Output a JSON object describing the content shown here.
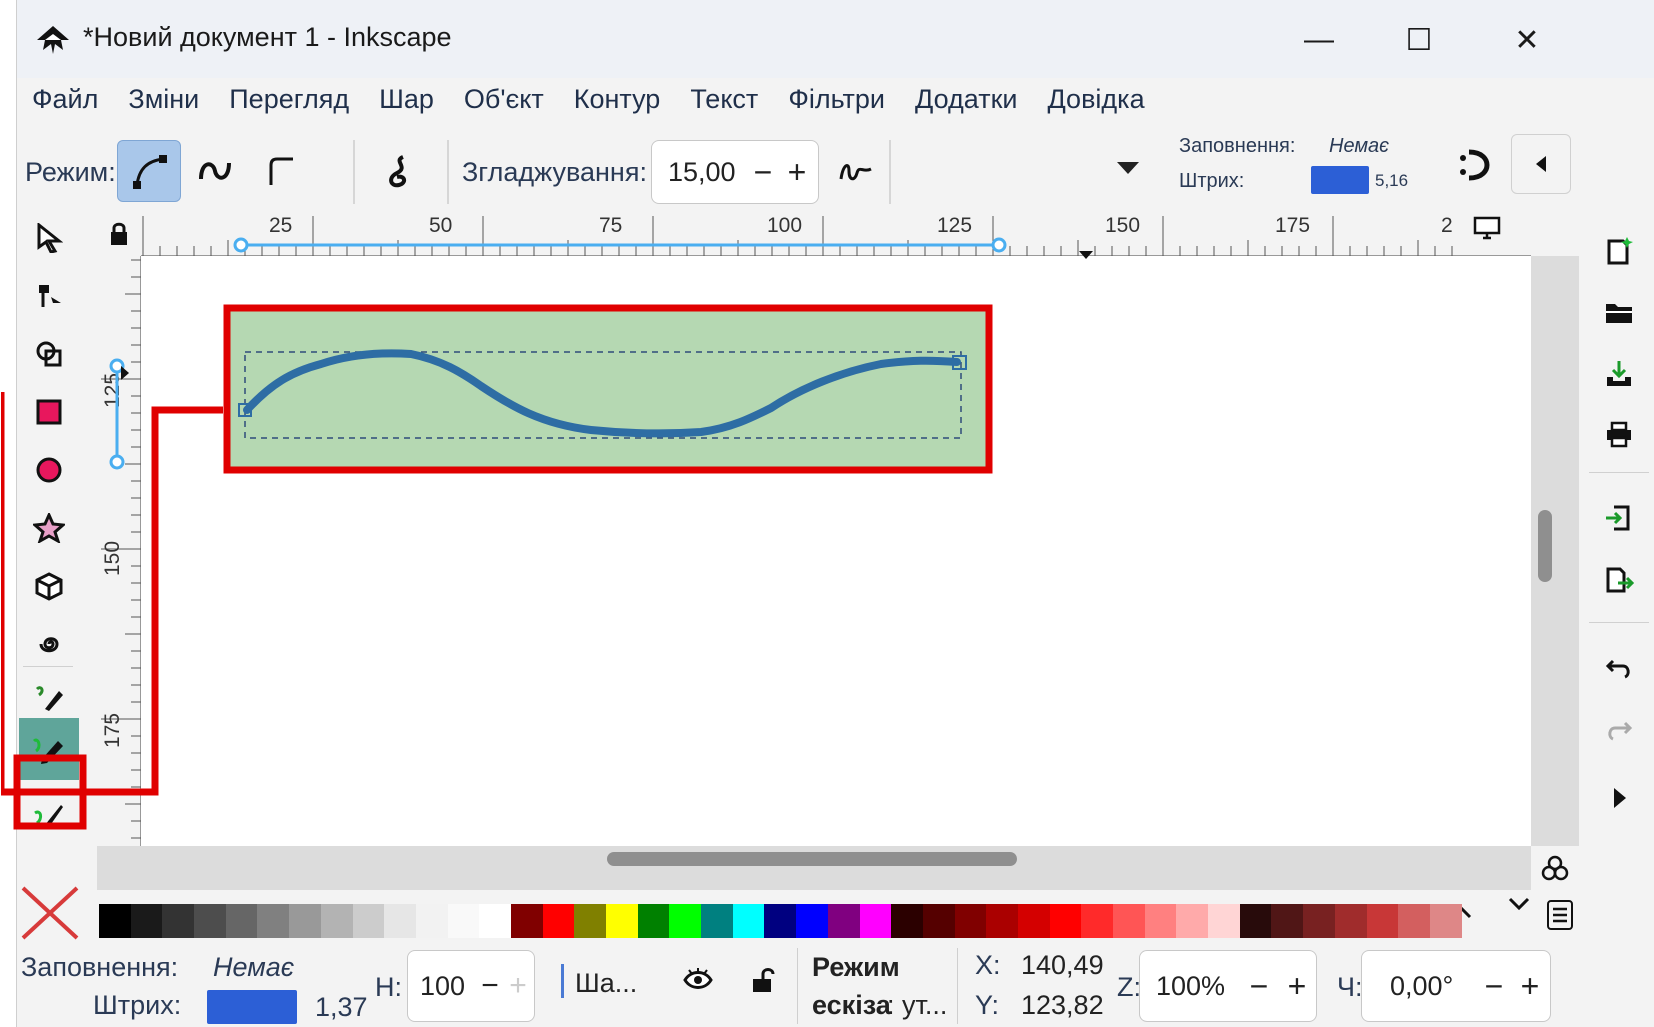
{
  "window": {
    "title": "*Новий документ 1 - Inkscape",
    "controls": {
      "minimize": "—",
      "maximize": "☐",
      "close": "✕"
    }
  },
  "menu": [
    "Файл",
    "Зміни",
    "Перегляд",
    "Шар",
    "Об'єкт",
    "Контур",
    "Текст",
    "Фільтри",
    "Додатки",
    "Довідка"
  ],
  "tool_controls": {
    "mode_label": "Режим:",
    "modes": [
      "bezier-mode-icon",
      "spiro-mode-icon",
      "bspline-mode-icon"
    ],
    "smoothing_label": "Згладжування:",
    "smoothing_value": "15,00",
    "minus": "−",
    "plus": "+",
    "fill_label": "Заповнення:",
    "fill_value": "Немає",
    "stroke_label": "Штрих:",
    "stroke_width": "5,16",
    "stroke_color": "#2c5fd6"
  },
  "rulers": {
    "top_labels": [
      "25",
      "50",
      "75",
      "100",
      "125",
      "150",
      "175",
      "2"
    ],
    "left_labels": [
      "125",
      "150",
      "175"
    ]
  },
  "canvas": {
    "highlight_fill": "#b5d8b2",
    "highlight_border": "#e00000",
    "path_color": "#2e6da4"
  },
  "palette": {
    "colors": [
      "#000000",
      "#1a1a1a",
      "#333333",
      "#4d4d4d",
      "#666666",
      "#808080",
      "#999999",
      "#b3b3b3",
      "#cccccc",
      "#e6e6e6",
      "#f2f2f2",
      "#f9f9f9",
      "#ffffff",
      "#800000",
      "#ff0000",
      "#808000",
      "#ffff00",
      "#008000",
      "#00ff00",
      "#008080",
      "#00ffff",
      "#000080",
      "#0000ff",
      "#800080",
      "#ff00ff",
      "#2b0000",
      "#550000",
      "#800000",
      "#aa0000",
      "#d40000",
      "#ff0000",
      "#ff2a2a",
      "#ff5555",
      "#ff8080",
      "#ffaaaa",
      "#ffd5d5",
      "#280b0b",
      "#501616",
      "#782121",
      "#a02c2c",
      "#c83737",
      "#d35f5f",
      "#de8787"
    ]
  },
  "status": {
    "fill_label": "Заповнення:",
    "fill_value": "Немає",
    "stroke_label": "Штрих:",
    "stroke_width": "1,37",
    "stroke_color": "#2c5fd6",
    "h_label": "Н:",
    "h_value": "100",
    "layer_label": "Ша...",
    "mode_title": "Режим",
    "mode_detail_bold": "ескіза",
    "mode_detail_rest": ": ут...",
    "x_label": "X:",
    "x_value": "140,49",
    "y_label": "Y:",
    "y_value": "123,82",
    "z_label": "Z:",
    "zoom_value": "100%",
    "rot_label": "Ч:",
    "rot_value": "0,00°",
    "minus": "−",
    "plus": "+"
  }
}
